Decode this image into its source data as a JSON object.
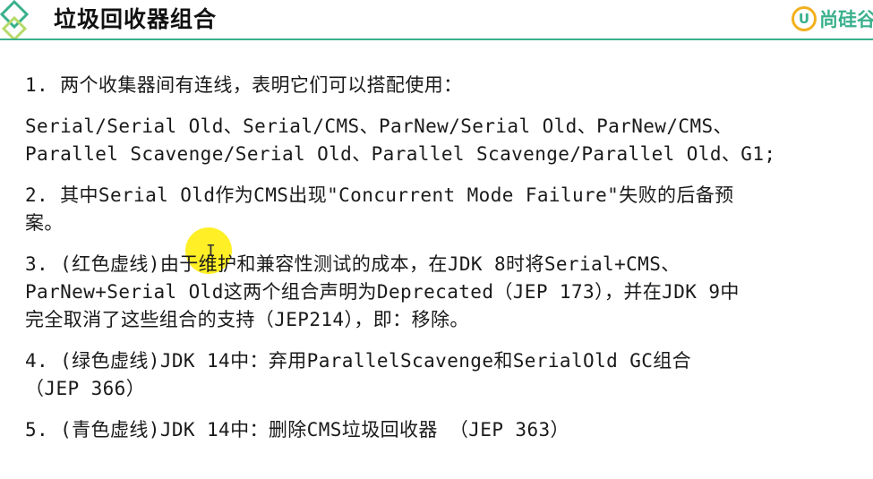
{
  "header": {
    "title": "垃圾回收器组合",
    "brand_mark": "U",
    "brand_text": "尚硅谷",
    "accent_color": "#3ab08c"
  },
  "paragraphs": [
    {
      "lines": [
        "1. 两个收集器间有连线，表明它们可以搭配使用："
      ]
    },
    {
      "lines": [
        "Serial/Serial Old、Serial/CMS、ParNew/Serial Old、ParNew/CMS、",
        "Parallel Scavenge/Serial Old、Parallel Scavenge/Parallel Old、G1;"
      ]
    },
    {
      "lines": [
        "2. 其中Serial Old作为CMS出现\"Concurrent Mode Failure\"失败的后备预",
        "案。"
      ]
    },
    {
      "lines": [
        "3. (红色虚线)由于维护和兼容性测试的成本，在JDK 8时将Serial+CMS、",
        "ParNew+Serial Old这两个组合声明为Deprecated（JEP 173），并在JDK 9中",
        "完全取消了这些组合的支持（JEP214），即：移除。"
      ]
    },
    {
      "lines": [
        "4. (绿色虚线)JDK 14中：弃用ParallelScavenge和SerialOld GC组合",
        "（JEP 366）"
      ]
    },
    {
      "lines": [
        "5. (青色虚线)JDK 14中：删除CMS垃圾回收器 （JEP 363）"
      ]
    }
  ],
  "cursor_glyph": "I"
}
